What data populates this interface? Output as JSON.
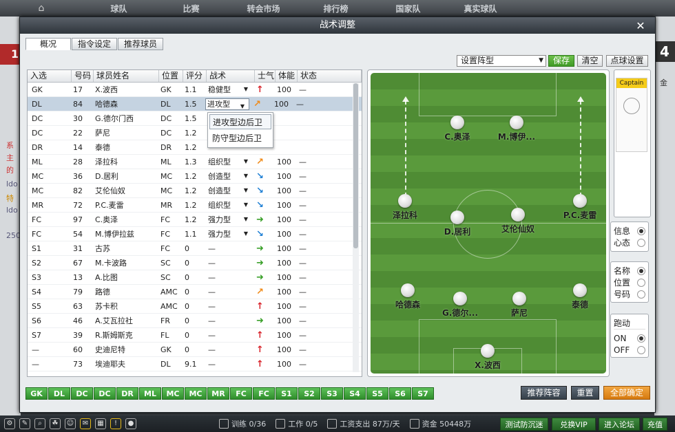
{
  "nav": {
    "home": "⌂",
    "items": [
      "球队",
      "比赛",
      "转会市场",
      "排行榜",
      "国家队",
      "真实球队"
    ]
  },
  "background": {
    "red_badge": "1",
    "right_badge": "4",
    "left_texts": [
      "系",
      "主",
      "的",
      "ldo",
      "特",
      "ldo",
      "250"
    ],
    "right_text": "金"
  },
  "dialog": {
    "title": "战术调整",
    "close": "✕"
  },
  "tabs": [
    "概况",
    "指令设定",
    "推荐球员"
  ],
  "toolbar": {
    "formation_select": "设置阵型",
    "save": "保存",
    "clear": "清空",
    "set_piece": "点球设置"
  },
  "table": {
    "headers": [
      "入选",
      "号码",
      "球员姓名",
      "位置",
      "评分",
      "战术",
      "士气",
      "体能",
      "状态"
    ],
    "rows": [
      {
        "sel": "GK",
        "num": "17",
        "name": "X.波西",
        "pos": "GK",
        "rating": "1.1",
        "tactic": "稳健型",
        "arrow": "up",
        "stamina": "100",
        "status": "—"
      },
      {
        "sel": "DL",
        "num": "84",
        "name": "哈德森",
        "pos": "DL",
        "rating": "1.5",
        "tactic": "进攻型",
        "arrow": "ur",
        "stamina": "100",
        "status": "—"
      },
      {
        "sel": "DC",
        "num": "30",
        "name": "G.德尔门西",
        "pos": "DC",
        "rating": "1.5",
        "tactic": "",
        "arrow": "",
        "stamina": "",
        "status": ""
      },
      {
        "sel": "DC",
        "num": "22",
        "name": "萨尼",
        "pos": "DC",
        "rating": "1.2",
        "tactic": "",
        "arrow": "",
        "stamina": "",
        "status": ""
      },
      {
        "sel": "DR",
        "num": "14",
        "name": "泰德",
        "pos": "DR",
        "rating": "1.2",
        "tactic": "",
        "arrow": "",
        "stamina": "",
        "status": ""
      },
      {
        "sel": "ML",
        "num": "28",
        "name": "泽拉科",
        "pos": "ML",
        "rating": "1.3",
        "tactic": "组织型",
        "arrow": "ur",
        "stamina": "100",
        "status": "—"
      },
      {
        "sel": "MC",
        "num": "36",
        "name": "D.居利",
        "pos": "MC",
        "rating": "1.2",
        "tactic": "创造型",
        "arrow": "dn",
        "stamina": "100",
        "status": "—"
      },
      {
        "sel": "MC",
        "num": "82",
        "name": "艾伦仙奴",
        "pos": "MC",
        "rating": "1.2",
        "tactic": "创造型",
        "arrow": "dn",
        "stamina": "100",
        "status": "—"
      },
      {
        "sel": "MR",
        "num": "72",
        "name": "P.C.麦雷",
        "pos": "MR",
        "rating": "1.2",
        "tactic": "组织型",
        "arrow": "dn",
        "stamina": "100",
        "status": "—"
      },
      {
        "sel": "FC",
        "num": "97",
        "name": "C.奥泽",
        "pos": "FC",
        "rating": "1.2",
        "tactic": "强力型",
        "arrow": "r",
        "stamina": "100",
        "status": "—"
      },
      {
        "sel": "FC",
        "num": "54",
        "name": "M.博伊拉兹",
        "pos": "FC",
        "rating": "1.1",
        "tactic": "强力型",
        "arrow": "dn",
        "stamina": "100",
        "status": "—"
      },
      {
        "sel": "S1",
        "num": "31",
        "name": "古苏",
        "pos": "FC",
        "rating": "0",
        "tactic": "—",
        "arrow": "r",
        "stamina": "100",
        "status": "—"
      },
      {
        "sel": "S2",
        "num": "67",
        "name": "M.卡波路",
        "pos": "SC",
        "rating": "0",
        "tactic": "—",
        "arrow": "r",
        "stamina": "100",
        "status": "—"
      },
      {
        "sel": "S3",
        "num": "13",
        "name": "A.比图",
        "pos": "SC",
        "rating": "0",
        "tactic": "—",
        "arrow": "r",
        "stamina": "100",
        "status": "—"
      },
      {
        "sel": "S4",
        "num": "79",
        "name": "路德",
        "pos": "AMC",
        "rating": "0",
        "tactic": "—",
        "arrow": "ur",
        "stamina": "100",
        "status": "—"
      },
      {
        "sel": "S5",
        "num": "63",
        "name": "苏卡积",
        "pos": "AMC",
        "rating": "0",
        "tactic": "—",
        "arrow": "up",
        "stamina": "100",
        "status": "—"
      },
      {
        "sel": "S6",
        "num": "46",
        "name": "A.艾瓦拉社",
        "pos": "FR",
        "rating": "0",
        "tactic": "—",
        "arrow": "r",
        "stamina": "100",
        "status": "—"
      },
      {
        "sel": "S7",
        "num": "39",
        "name": "R.斯姆斯克",
        "pos": "FL",
        "rating": "0",
        "tactic": "—",
        "arrow": "up",
        "stamina": "100",
        "status": "—"
      },
      {
        "sel": "—",
        "num": "60",
        "name": "史迪尼特",
        "pos": "GK",
        "rating": "0",
        "tactic": "—",
        "arrow": "up",
        "stamina": "100",
        "status": "—"
      },
      {
        "sel": "—",
        "num": "73",
        "name": "埃迪耶夫",
        "pos": "DL",
        "rating": "9.1",
        "tactic": "—",
        "arrow": "up",
        "stamina": "100",
        "status": "—"
      }
    ]
  },
  "popup": {
    "options": [
      "进攻型边后卫",
      "防守型边后卫"
    ]
  },
  "position_bar": [
    "GK",
    "DL",
    "DC",
    "DC",
    "DR",
    "ML",
    "MC",
    "MC",
    "MR",
    "FC",
    "FC",
    "S1",
    "S2",
    "S3",
    "S4",
    "S5",
    "S6",
    "S7"
  ],
  "pitch": {
    "players": [
      {
        "name": "C.奥泽",
        "role": "FC1"
      },
      {
        "name": "M.博伊...",
        "role": "FC2"
      },
      {
        "name": "泽拉科",
        "role": "ML"
      },
      {
        "name": "P.C.麦雷",
        "role": "MR"
      },
      {
        "name": "D.居利",
        "role": "MC1"
      },
      {
        "name": "艾伦仙奴",
        "role": "MC2"
      },
      {
        "name": "哈德森",
        "role": "DL"
      },
      {
        "name": "G.德尔...",
        "role": "DC1"
      },
      {
        "name": "萨尼",
        "role": "DC2"
      },
      {
        "name": "泰德",
        "role": "DR"
      },
      {
        "name": "X.波西",
        "role": "GK"
      }
    ]
  },
  "captain": {
    "label": "Captain"
  },
  "info_group": {
    "options": [
      "信息",
      "心态"
    ]
  },
  "display_group": {
    "options": [
      "名称",
      "位置",
      "号码"
    ]
  },
  "run_group": {
    "title": "跑动",
    "options": [
      "ON",
      "OFF"
    ]
  },
  "bottom_buttons": {
    "recommend": "推荐阵容",
    "reset": "重置",
    "confirm": "全部确定"
  },
  "status_bar": {
    "training": "训练 0/36",
    "work": "工作 0/5",
    "wages": "工资支出 87万/天",
    "funds": "资金 50448万",
    "buttons": [
      "测试防沉迷",
      "兑换VIP",
      "进入论坛",
      "充值"
    ]
  }
}
